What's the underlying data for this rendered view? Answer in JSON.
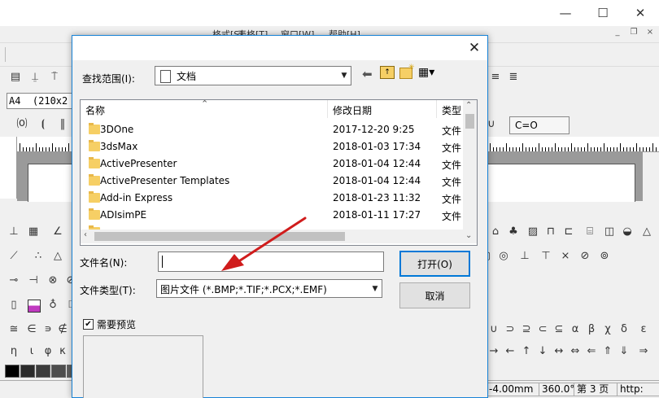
{
  "app": {
    "menus": [
      "…格式[S]",
      "表格[T]",
      "窗口[W]",
      "帮助[H]"
    ],
    "window_controls": {
      "minimize": "—",
      "maximize": "☐",
      "close": "✕"
    },
    "mdi_controls": {
      "minimize": "_",
      "restore": "❐",
      "close": "×"
    },
    "page_size_field": "A4  (210x2",
    "right_toolbar_symbol": "C=O",
    "palette_colors": [
      "#000000",
      "#2b2b2b",
      "#3c3c3c",
      "#4d4d4d",
      "#5e5e5e",
      "#6f6f6f",
      "#808080",
      "#919191",
      "#a2a2a2",
      "#b3b3b3",
      "#c4c4c4",
      "#d5d5d5",
      "#e6e6e6",
      "#f7f7f7",
      "#ffffff",
      "#ffffff"
    ],
    "math_symbols_left": [
      "≅",
      "∈",
      "∍",
      "∉"
    ],
    "greek_left": [
      "η",
      "ι",
      "φ",
      "κ"
    ],
    "math_symbols_right": [
      "∪",
      "⊃",
      "⊇",
      "⊂",
      "⊆",
      "α",
      "β",
      "χ",
      "δ",
      "ε"
    ],
    "arrows_right": [
      "→",
      "←",
      "↑",
      "↓",
      "↔",
      "⇔",
      "⇐",
      "⇑",
      "⇓",
      "⇒"
    ],
    "status": {
      "line_width": "-4.00mm",
      "angle": "360.0°",
      "page": "第 3 页",
      "url": "http:"
    }
  },
  "dialog": {
    "close_glyph": "✕",
    "look_in_label": "查找范围(I):",
    "look_in_value": "文档",
    "columns": {
      "name": "名称",
      "modified": "修改日期",
      "type": "类型"
    },
    "files": [
      {
        "name": "3DOne",
        "modified": "2017-12-20 9:25",
        "type": "文件"
      },
      {
        "name": "3dsMax",
        "modified": "2018-01-03 17:34",
        "type": "文件"
      },
      {
        "name": "ActivePresenter",
        "modified": "2018-01-04 12:44",
        "type": "文件"
      },
      {
        "name": "ActivePresenter Templates",
        "modified": "2018-01-04 12:44",
        "type": "文件"
      },
      {
        "name": "Add-in Express",
        "modified": "2018-01-23 11:32",
        "type": "文件"
      },
      {
        "name": "ADIsimPE",
        "modified": "2018-01-11 17:27",
        "type": "文件"
      }
    ],
    "filename_label": "文件名(N):",
    "filename_value": "",
    "filetype_label": "文件类型(T):",
    "filetype_value": "图片文件 (*.BMP;*.TIF;*.PCX;*.EMF)",
    "open_button": "打开(O)",
    "cancel_button": "取消",
    "preview_label": "需要预览",
    "preview_checked": "✔"
  }
}
